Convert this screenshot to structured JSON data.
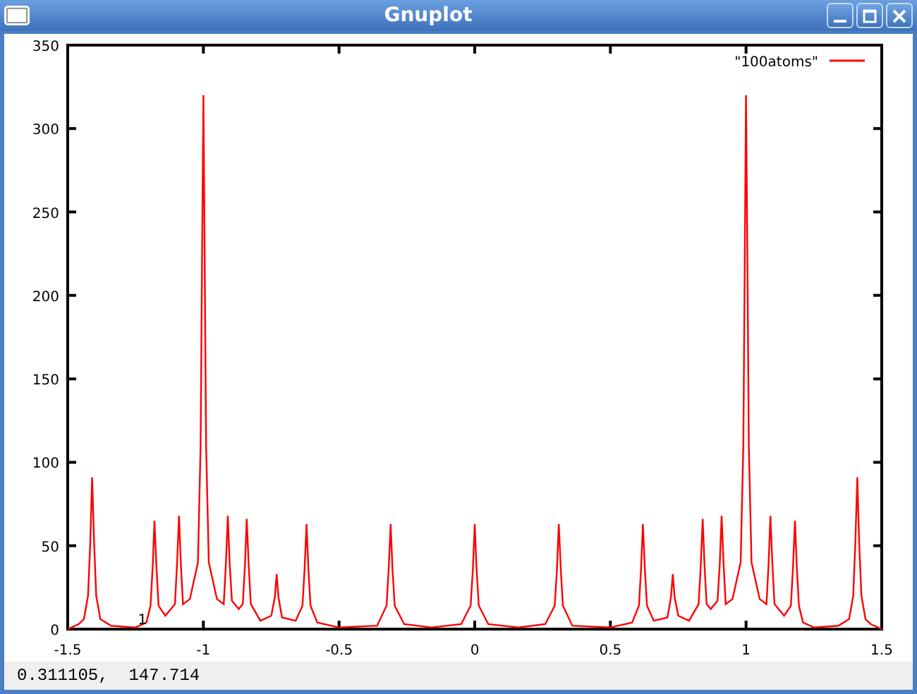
{
  "window": {
    "title": "Gnuplot"
  },
  "plot": {
    "chart_data": {
      "type": "line",
      "x": [
        -1.5,
        -1.46,
        -1.44,
        -1.425,
        -1.417,
        -1.41,
        -1.403,
        -1.395,
        -1.38,
        -1.34,
        -1.25,
        -1.21,
        -1.195,
        -1.187,
        -1.18,
        -1.173,
        -1.165,
        -1.14,
        -1.105,
        -1.097,
        -1.09,
        -1.083,
        -1.075,
        -1.05,
        -1.02,
        -1.01,
        -1.005,
        -1.0,
        -0.995,
        -0.99,
        -0.98,
        -0.95,
        -0.925,
        -0.917,
        -0.91,
        -0.903,
        -0.895,
        -0.87,
        -0.855,
        -0.847,
        -0.84,
        -0.833,
        -0.825,
        -0.79,
        -0.75,
        -0.737,
        -0.73,
        -0.723,
        -0.71,
        -0.66,
        -0.635,
        -0.627,
        -0.62,
        -0.613,
        -0.605,
        -0.58,
        -0.5,
        -0.36,
        -0.325,
        -0.317,
        -0.31,
        -0.303,
        -0.295,
        -0.26,
        -0.16,
        -0.05,
        -0.015,
        -0.007,
        0,
        0.007,
        0.015,
        0.05,
        0.16,
        0.26,
        0.295,
        0.303,
        0.31,
        0.317,
        0.325,
        0.36,
        0.5,
        0.58,
        0.605,
        0.613,
        0.62,
        0.627,
        0.635,
        0.66,
        0.71,
        0.723,
        0.73,
        0.737,
        0.75,
        0.79,
        0.825,
        0.833,
        0.84,
        0.847,
        0.855,
        0.87,
        0.895,
        0.903,
        0.91,
        0.917,
        0.925,
        0.95,
        0.98,
        0.99,
        0.995,
        1.0,
        1.005,
        1.01,
        1.02,
        1.05,
        1.075,
        1.083,
        1.09,
        1.097,
        1.105,
        1.14,
        1.165,
        1.173,
        1.18,
        1.187,
        1.195,
        1.21,
        1.25,
        1.34,
        1.38,
        1.395,
        1.403,
        1.41,
        1.417,
        1.425,
        1.44,
        1.46,
        1.5
      ],
      "series": [
        {
          "name": "\"100atoms\"",
          "color": "#ff0000",
          "values": [
            0,
            3,
            6,
            20,
            52,
            91,
            52,
            20,
            6,
            2,
            1,
            4,
            14,
            37,
            65,
            37,
            14,
            8,
            15,
            39,
            68,
            39,
            15,
            18,
            40,
            110,
            220,
            320,
            220,
            110,
            40,
            18,
            15,
            39,
            68,
            39,
            17,
            12,
            15,
            38,
            66,
            38,
            15,
            5,
            8,
            19,
            33,
            19,
            7,
            5,
            14,
            36,
            63,
            36,
            14,
            4,
            1,
            2,
            14,
            36,
            63,
            36,
            14,
            3,
            1,
            3,
            14,
            36,
            63,
            36,
            14,
            3,
            1,
            3,
            14,
            36,
            63,
            36,
            14,
            2,
            1,
            4,
            14,
            36,
            63,
            36,
            14,
            5,
            7,
            19,
            33,
            19,
            8,
            5,
            15,
            38,
            66,
            38,
            15,
            12,
            17,
            39,
            68,
            39,
            15,
            18,
            40,
            110,
            220,
            320,
            220,
            110,
            40,
            18,
            15,
            39,
            68,
            39,
            15,
            8,
            14,
            37,
            65,
            37,
            14,
            4,
            1,
            2,
            6,
            20,
            52,
            91,
            52,
            20,
            6,
            3,
            0
          ]
        }
      ],
      "xlim": [
        -1.5,
        1.5
      ],
      "ylim": [
        0,
        350
      ],
      "xticks": [
        {
          "value": -1.5,
          "label": "-1.5"
        },
        {
          "value": -1,
          "label": "-1"
        },
        {
          "value": -0.5,
          "label": "-0.5"
        },
        {
          "value": 0,
          "label": "0"
        },
        {
          "value": 0.5,
          "label": "0.5"
        },
        {
          "value": 1,
          "label": "1"
        },
        {
          "value": 1.5,
          "label": "1.5"
        }
      ],
      "yticks": [
        {
          "value": 0,
          "label": "0"
        },
        {
          "value": 50,
          "label": "50"
        },
        {
          "value": 100,
          "label": "100"
        },
        {
          "value": 150,
          "label": "150"
        },
        {
          "value": 200,
          "label": "200"
        },
        {
          "value": 250,
          "label": "250"
        },
        {
          "value": 300,
          "label": "300"
        },
        {
          "value": 350,
          "label": "350"
        }
      ],
      "annotations": [
        {
          "x": -1.225,
          "y": 3,
          "text": "1"
        }
      ]
    }
  },
  "status_bar": {
    "text": "0.311105,  147.714"
  }
}
